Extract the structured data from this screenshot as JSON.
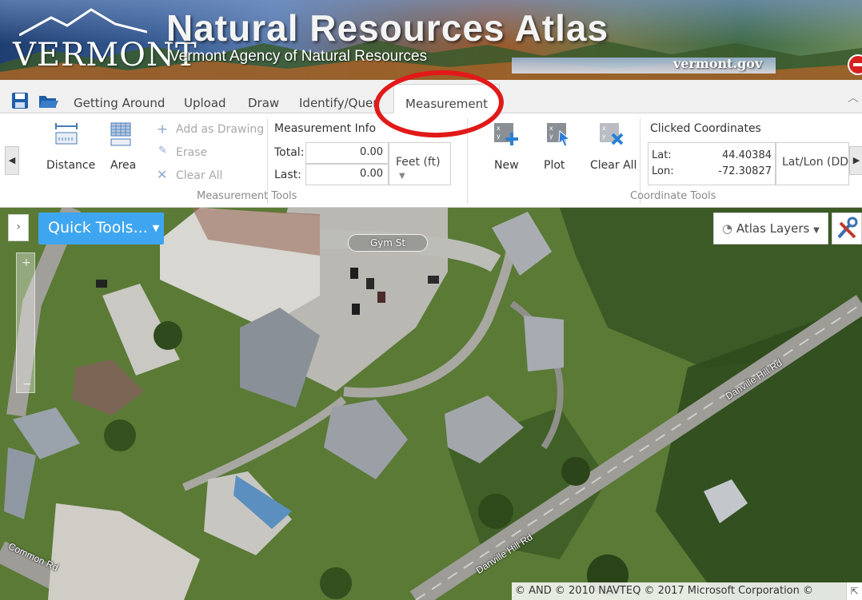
{
  "banner": {
    "logo_text": "VERMONT",
    "title": "Natural Resources Atlas",
    "subtitle": "Vermont Agency of Natural Resources",
    "gov_link": "vermont.gov"
  },
  "toolbar": {
    "save_icon": "save-icon",
    "open_icon": "folder-open-icon"
  },
  "tabs": [
    {
      "label": "Getting Around",
      "active": false
    },
    {
      "label": "Upload",
      "active": false
    },
    {
      "label": "Draw",
      "active": false
    },
    {
      "label": "Identify/Quer",
      "active": false
    },
    {
      "label": "Measurement",
      "active": true
    }
  ],
  "ribbon": {
    "measurement_tools": {
      "group_title": "Measurement Tools",
      "distance_label": "Distance",
      "area_label": "Area",
      "add_as_drawing": "Add as Drawing",
      "erase": "Erase",
      "clear_all": "Clear All"
    },
    "measurement_info": {
      "title": "Measurement Info",
      "total_label": "Total:",
      "total_value": "0.00",
      "last_label": "Last:",
      "last_value": "0.00",
      "unit": "Feet (ft)"
    },
    "coordinate_tools": {
      "group_title": "Coordinate Tools",
      "new_label": "New",
      "plot_label": "Plot",
      "clear_all_label": "Clear All",
      "clicked_title": "Clicked Coordinates",
      "lat_label": "Lat:",
      "lat_value": "44.40384",
      "lon_label": "Lon:",
      "lon_value": "-72.30827",
      "system": "Lat/Lon (DD)"
    }
  },
  "map": {
    "quick_tools": "Quick Tools...",
    "atlas_layers": "Atlas Layers",
    "streets": {
      "gym": "Gym St",
      "danville_upper": "Danville Hill Rd",
      "danville_lower": "Danville Hill Rd",
      "common": "Common Rd"
    },
    "attribution": "© AND © 2010 NAVTEQ © 2017 Microsoft Corporation ©"
  },
  "colors": {
    "accent_button": "#3ea6f0",
    "annotation_circle": "#e11919"
  }
}
